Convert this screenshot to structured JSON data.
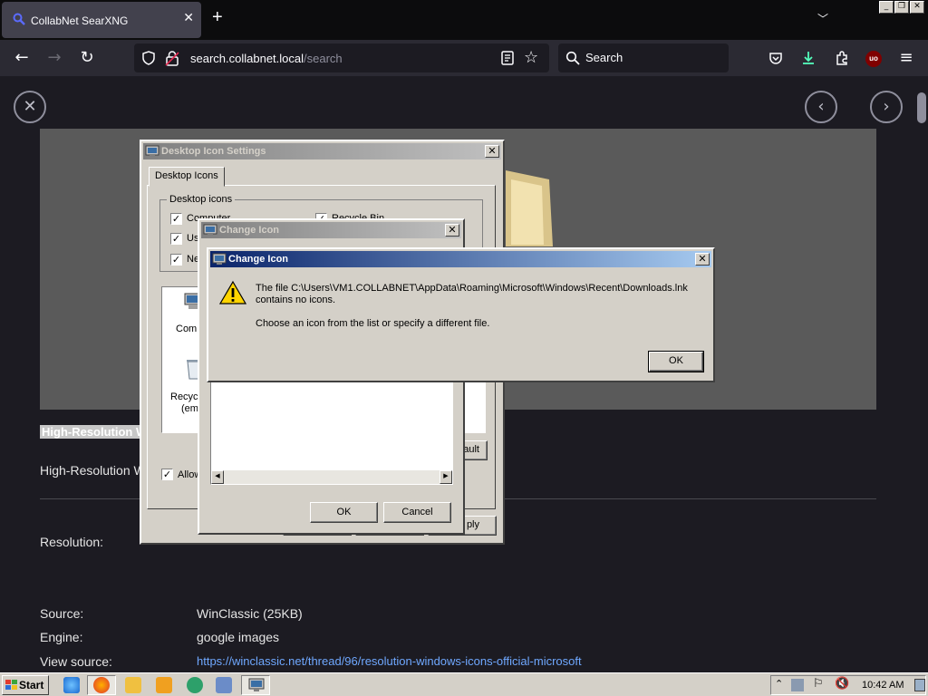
{
  "browser": {
    "tab_title": "CollabNet SearXNG",
    "new_tab": "+",
    "url_host": "search.collabnet.local",
    "url_path": "/search",
    "search_placeholder": "Search",
    "ext_badge": "uo"
  },
  "result": {
    "title_highlight": "High-Resolution W",
    "subtitle": "High-Resolution Wi",
    "resolution_label": "Resolution:",
    "source_label": "Source:",
    "source_value": "WinClassic (25KB)",
    "engine_label": "Engine:",
    "engine_value": "google images",
    "view_source_label": "View source:",
    "view_source_url": "https://winclassic.net/thread/96/resolution-windows-icons-official-microsoft"
  },
  "desktop_icon_settings": {
    "title": "Desktop Icon Settings",
    "tab": "Desktop Icons",
    "group": "Desktop icons",
    "chk_computer": "Computer",
    "chk_recycle": "Recycle Bin",
    "chk_user": "Us",
    "chk_network": "Ne",
    "icon_computer": "Comp",
    "icon_recycle": "Recyc",
    "icon_recycle_sub": "(emp",
    "allow_label": "Allow",
    "default_btn": "ault",
    "apply_btn": "ply"
  },
  "change_icon_back": {
    "title": "Change Icon",
    "ok": "OK",
    "cancel": "Cancel"
  },
  "change_icon_alert": {
    "title": "Change Icon",
    "line1": "The file C:\\Users\\VM1.COLLABNET\\AppData\\Roaming\\Microsoft\\Windows\\Recent\\Downloads.lnk",
    "line2": "contains no icons.",
    "line3": "Choose an icon from the list or specify a different file.",
    "ok": "OK"
  },
  "taskbar": {
    "start": "Start",
    "clock": "10:42 AM"
  }
}
